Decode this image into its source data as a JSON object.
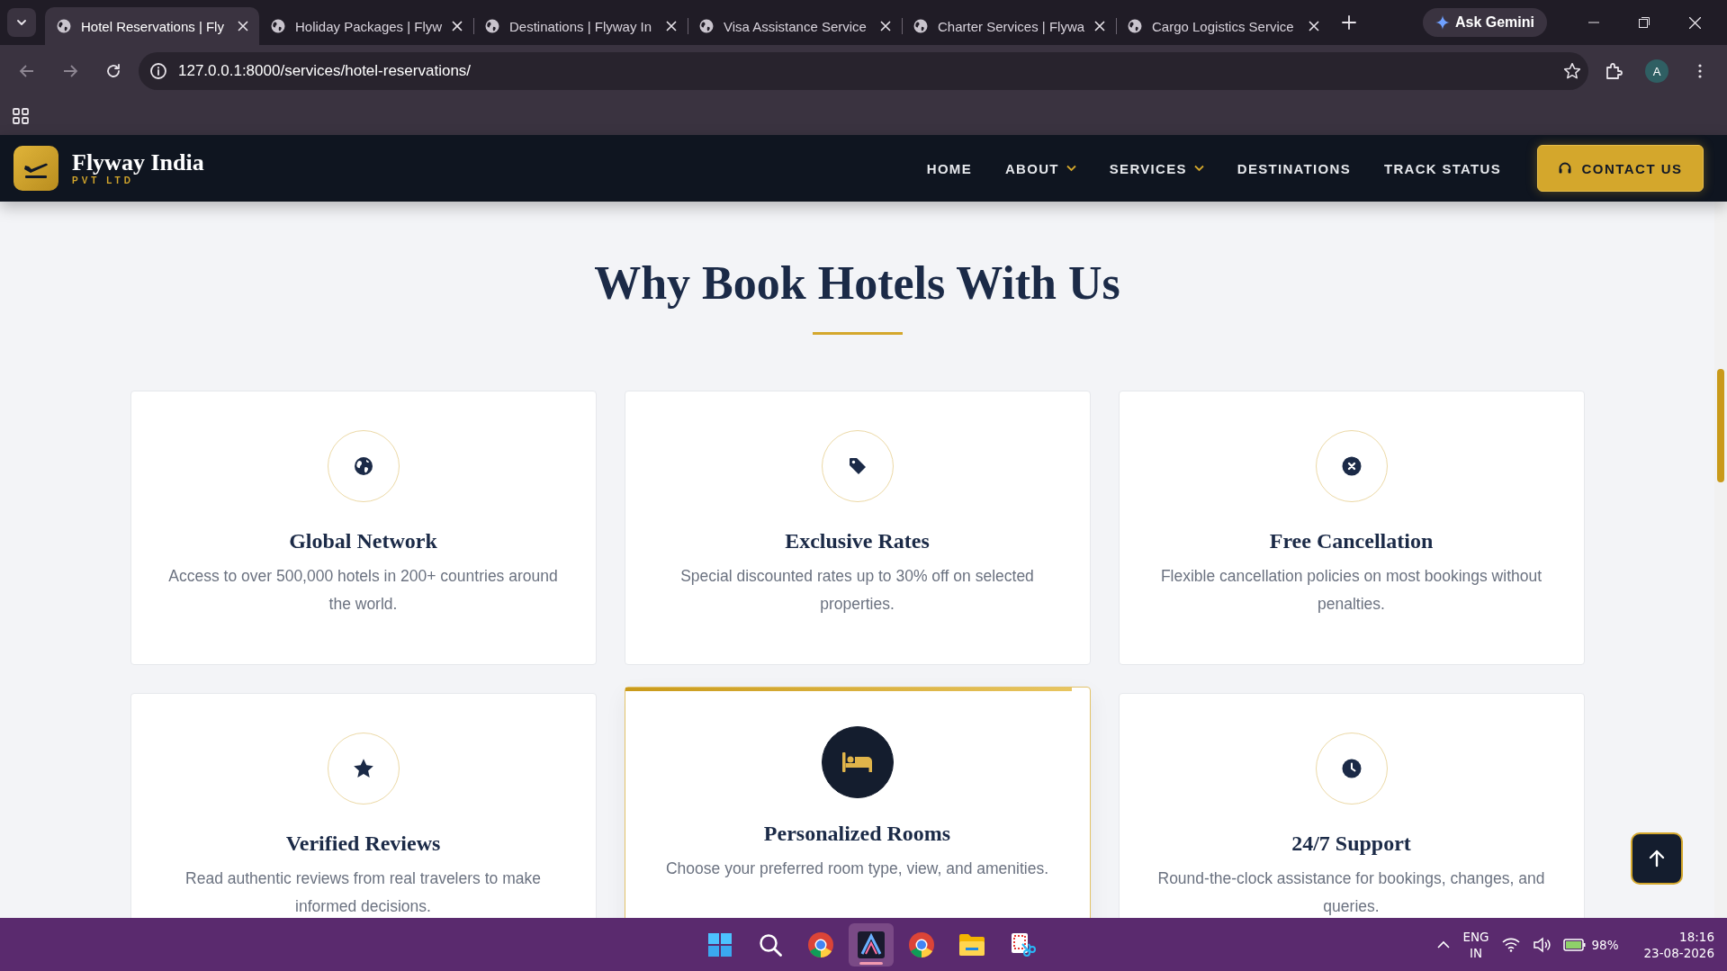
{
  "browser": {
    "tabs": [
      {
        "title": "Hotel Reservations | Fly",
        "selected": true
      },
      {
        "title": "Holiday Packages | Flyw",
        "selected": false
      },
      {
        "title": "Destinations | Flyway In",
        "selected": false
      },
      {
        "title": "Visa Assistance Service",
        "selected": false
      },
      {
        "title": "Charter Services | Flywa",
        "selected": false
      },
      {
        "title": "Cargo Logistics Service",
        "selected": false
      }
    ],
    "ask_button": "Ask Gemini",
    "address": "127.0.0.1:8000/services/hotel-reservations/",
    "profile_initial": "A"
  },
  "site_header": {
    "brand_name": "Flyway India",
    "brand_tagline": "PVT LTD",
    "nav": [
      {
        "label": "HOME",
        "dropdown": false
      },
      {
        "label": "ABOUT",
        "dropdown": true
      },
      {
        "label": "SERVICES",
        "dropdown": true
      },
      {
        "label": "DESTINATIONS",
        "dropdown": false
      },
      {
        "label": "TRACK STATUS",
        "dropdown": false
      }
    ],
    "contact_button": "CONTACT US"
  },
  "section": {
    "title": "Why Book Hotels With Us",
    "features": [
      {
        "kind": "globe",
        "title": "Global Network",
        "description": "Access to over 500,000 hotels in 200+ countries around the world.",
        "highlighted": false
      },
      {
        "kind": "tag",
        "title": "Exclusive Rates",
        "description": "Special discounted rates up to 30% off on selected properties.",
        "highlighted": false
      },
      {
        "kind": "cancel",
        "title": "Free Cancellation",
        "description": "Flexible cancellation policies on most bookings without penalties.",
        "highlighted": false
      },
      {
        "kind": "star",
        "title": "Verified Reviews",
        "description": "Read authentic reviews from real travelers to make informed decisions.",
        "highlighted": false
      },
      {
        "kind": "bed",
        "title": "Personalized Rooms",
        "description": "Choose your preferred room type, view, and amenities.",
        "highlighted": true
      },
      {
        "kind": "clock",
        "title": "24/7 Support",
        "description": "Round-the-clock assistance for bookings, changes, and queries.",
        "highlighted": false
      }
    ]
  },
  "taskbar": {
    "apps": [
      {
        "kind": "start",
        "active": false
      },
      {
        "kind": "search",
        "active": false
      },
      {
        "kind": "browser",
        "active": false
      },
      {
        "kind": "editor",
        "active": true
      },
      {
        "kind": "browser",
        "active": false
      },
      {
        "kind": "folder",
        "active": false
      },
      {
        "kind": "snip",
        "active": false
      }
    ],
    "language": "ENG",
    "region": "IN",
    "battery": "98%",
    "time": "18:16",
    "date": "23-08-2026"
  }
}
